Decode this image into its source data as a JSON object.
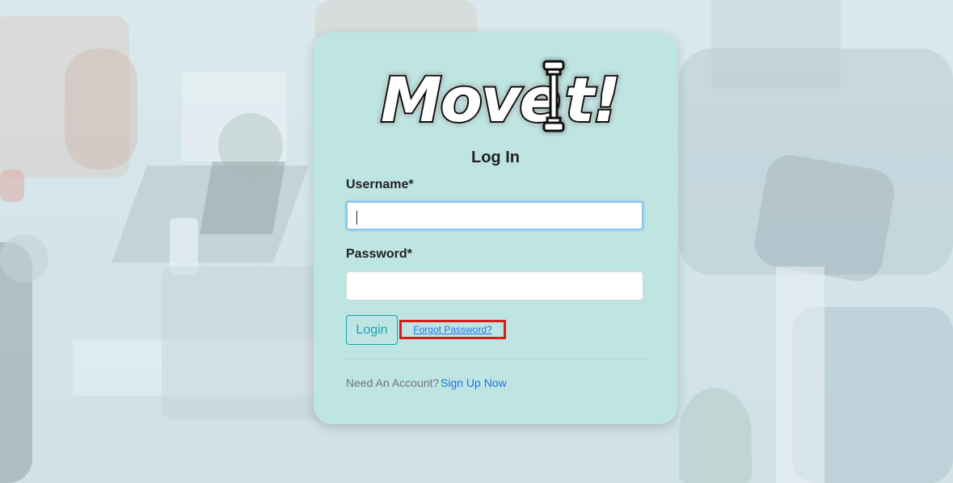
{
  "brand": {
    "logo_text": "MoveIt!",
    "accent_color": "#17a2b8",
    "card_color": "#bfe5e3"
  },
  "form": {
    "heading": "Log In",
    "username_label": "Username*",
    "username_value": "",
    "password_label": "Password*",
    "password_value": "",
    "login_label": "Login",
    "forgot_label": "Forgot Password?",
    "need_account": "Need An Account?",
    "signup_label": "Sign Up Now"
  }
}
